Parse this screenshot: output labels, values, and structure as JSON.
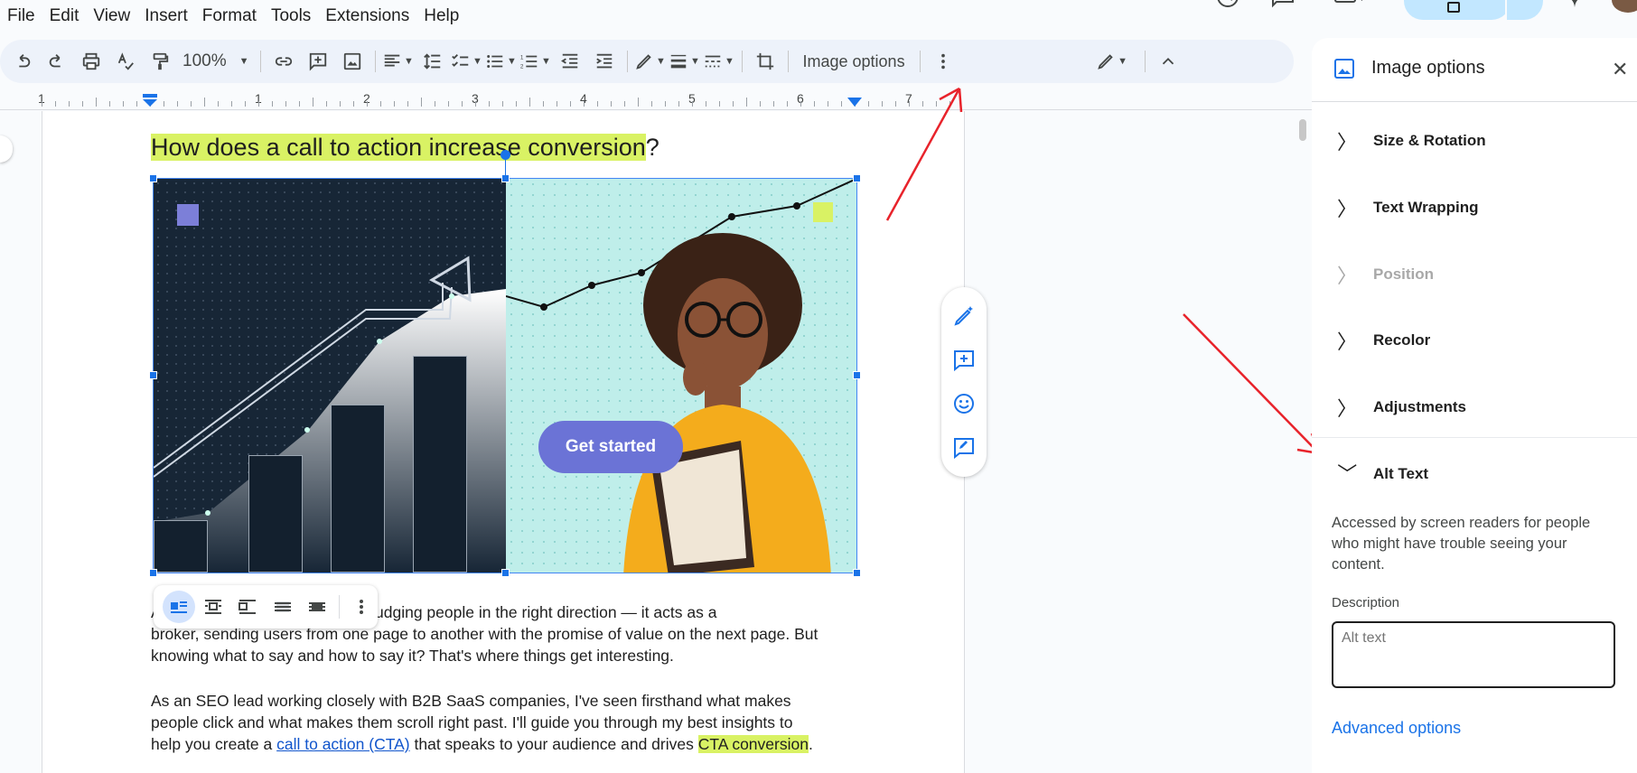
{
  "menu": [
    "File",
    "Edit",
    "View",
    "Insert",
    "Format",
    "Tools",
    "Extensions",
    "Help"
  ],
  "toolbar": {
    "zoom": "100%",
    "image_options_label": "Image options",
    "icons": [
      "undo-icon",
      "redo-icon",
      "print-icon",
      "spellcheck-icon",
      "paint-format-icon",
      "link-icon",
      "add-comment-icon",
      "insert-image-icon",
      "align-icon",
      "line-spacing-icon",
      "checklist-icon",
      "bulleted-list-icon",
      "numbered-list-icon",
      "decrease-indent-icon",
      "increase-indent-icon",
      "border-color-icon",
      "border-weight-icon",
      "border-dash-icon",
      "crop-icon",
      "more-icon",
      "editing-mode-icon",
      "collapse-icon"
    ]
  },
  "ruler": {
    "numbers": [
      "1",
      "1",
      "2",
      "3",
      "4",
      "5",
      "6",
      "7"
    ]
  },
  "document": {
    "heading_highlighted": "How does a call to action increase conversion",
    "heading_tail": "?",
    "para1_line1": "A                                     on by nudging people in the right direction — it acts as a",
    "para1_line2": "broker, sending users from one page to another with the promise of value on the next page. But",
    "para1_line3": "knowing what to say and how to say it? That's where things get interesting.",
    "para2_line1": "As an SEO lead working closely with B2B SaaS companies, I've seen firsthand what makes",
    "para2_line2": "people click and what makes them scroll right past. I'll guide you through my best insights to",
    "para2_line3_a": "help you create a ",
    "para2_link": "call to action (CTA)",
    "para2_line3_b": " that speaks to your audience and drives ",
    "para2_highlight": "CTA conversion",
    "para2_end": "."
  },
  "image": {
    "button_text": "Get started"
  },
  "side_actions": [
    "ai-edit-icon",
    "add-comment-icon",
    "emoji-icon",
    "suggest-edit-icon"
  ],
  "panel": {
    "title": "Image options",
    "sections": [
      {
        "label": "Size & Rotation",
        "expanded": false,
        "disabled": false
      },
      {
        "label": "Text Wrapping",
        "expanded": false,
        "disabled": false
      },
      {
        "label": "Position",
        "expanded": false,
        "disabled": true
      },
      {
        "label": "Recolor",
        "expanded": false,
        "disabled": false
      },
      {
        "label": "Adjustments",
        "expanded": false,
        "disabled": false
      },
      {
        "label": "Alt Text",
        "expanded": true,
        "disabled": false
      }
    ],
    "alt_desc": "Accessed by screen readers for people who might have trouble seeing your content.",
    "description_label": "Description",
    "description_placeholder": "Alt text",
    "advanced_link": "Advanced options"
  },
  "colors": {
    "accent": "#1a73e8",
    "highlight": "#d9f264",
    "annotation_arrow": "#e8232b",
    "share_bg": "#c2e7ff"
  }
}
